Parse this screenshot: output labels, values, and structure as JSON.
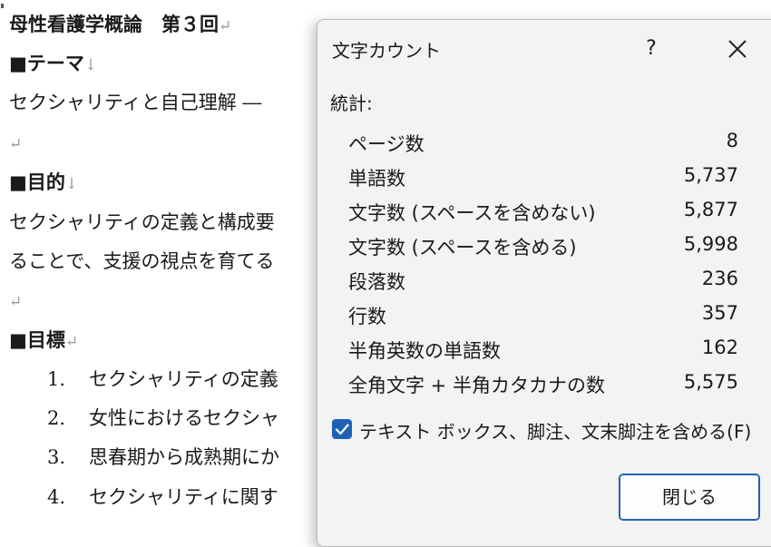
{
  "document": {
    "title_line": "母性看護学概論　第３回",
    "theme_heading": "■テーマ",
    "theme_text": "セクシャリティと自己理解 ―",
    "purpose_heading": "■目的",
    "purpose_text_1": "セクシャリティの定義と構成要",
    "purpose_text_2": "ることで、支援の視点を育てる",
    "goals_heading": "■目標",
    "goals": [
      {
        "num": "1.",
        "text": "セクシャリティの定義"
      },
      {
        "num": "2.",
        "text": "女性におけるセクシャ"
      },
      {
        "num": "3.",
        "text": "思春期から成熟期にか"
      },
      {
        "num": "4.",
        "text": "セクシャリティに関す"
      }
    ],
    "para_mark": "↵",
    "line_break_mark": "↓"
  },
  "dialog": {
    "title": "文字カウント",
    "help_label": "?",
    "stats_label": "統計:",
    "stats": [
      {
        "label": "ページ数",
        "value": "8"
      },
      {
        "label": "単語数",
        "value": "5,737"
      },
      {
        "label": "文字数 (スペースを含めない)",
        "value": "5,877"
      },
      {
        "label": "文字数 (スペースを含める)",
        "value": "5,998"
      },
      {
        "label": "段落数",
        "value": "236"
      },
      {
        "label": "行数",
        "value": "357"
      },
      {
        "label": "半角英数の単語数",
        "value": "162"
      },
      {
        "label": "全角文字 + 半角カタカナの数",
        "value": "5,575"
      }
    ],
    "checkbox_label": "テキスト ボックス、脚注、文末脚注を含める(F)",
    "checkbox_checked": true,
    "close_button": "閉じる",
    "accent_color": "#1f62b4"
  }
}
